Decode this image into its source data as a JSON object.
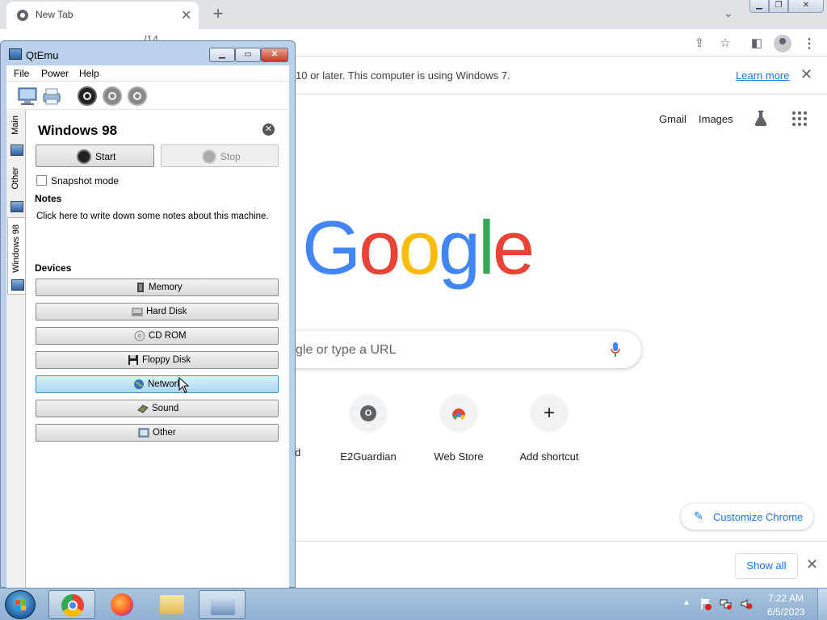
{
  "browser": {
    "tab_title": "New Tab",
    "tab_close": "✕",
    "new_tab": "+",
    "omnibox_partial": "/14",
    "infobar_text": "10 or later. This computer is using Windows 7.",
    "learn_more": "Learn more",
    "gmail": "Gmail",
    "images": "Images",
    "search_placeholder_partial": "gle or type a URL",
    "partial_shortcut_label": "d",
    "shortcuts": [
      {
        "label": "E2Guardian",
        "badge": "O"
      },
      {
        "label": "Web Store"
      },
      {
        "label": "Add shortcut",
        "glyph": "+"
      }
    ],
    "customize": "Customize Chrome",
    "show_all": "Show all",
    "close_glyph": "✕",
    "google_letters": [
      "G",
      "o",
      "o",
      "g",
      "l",
      "e"
    ]
  },
  "qtemu": {
    "title": "QtEmu",
    "menu": {
      "file": "File",
      "power": "Power",
      "help": "Help"
    },
    "side_tabs": {
      "main": "Main",
      "other": "Other",
      "vm": "Windows 98"
    },
    "vm_name": "Windows 98",
    "start": "Start",
    "stop": "Stop",
    "snapshot_mode": "Snapshot mode",
    "notes_heading": "Notes",
    "notes_text": "Click here to write down some notes about this machine.",
    "devices_heading": "Devices",
    "devices": {
      "memory": "Memory",
      "hard_disk": "Hard Disk",
      "cd_rom": "CD ROM",
      "floppy": "Floppy Disk",
      "network": "Network",
      "sound": "Sound",
      "other": "Other"
    }
  },
  "taskbar": {
    "time": "7:22 AM",
    "date": "6/5/2023"
  },
  "colors": {
    "google_blue": "#4285f4",
    "google_red": "#ea4335",
    "google_yellow": "#fbbc05",
    "google_green": "#34a853",
    "link_blue": "#1a73e8",
    "network_highlight": "#a8d8f4"
  }
}
